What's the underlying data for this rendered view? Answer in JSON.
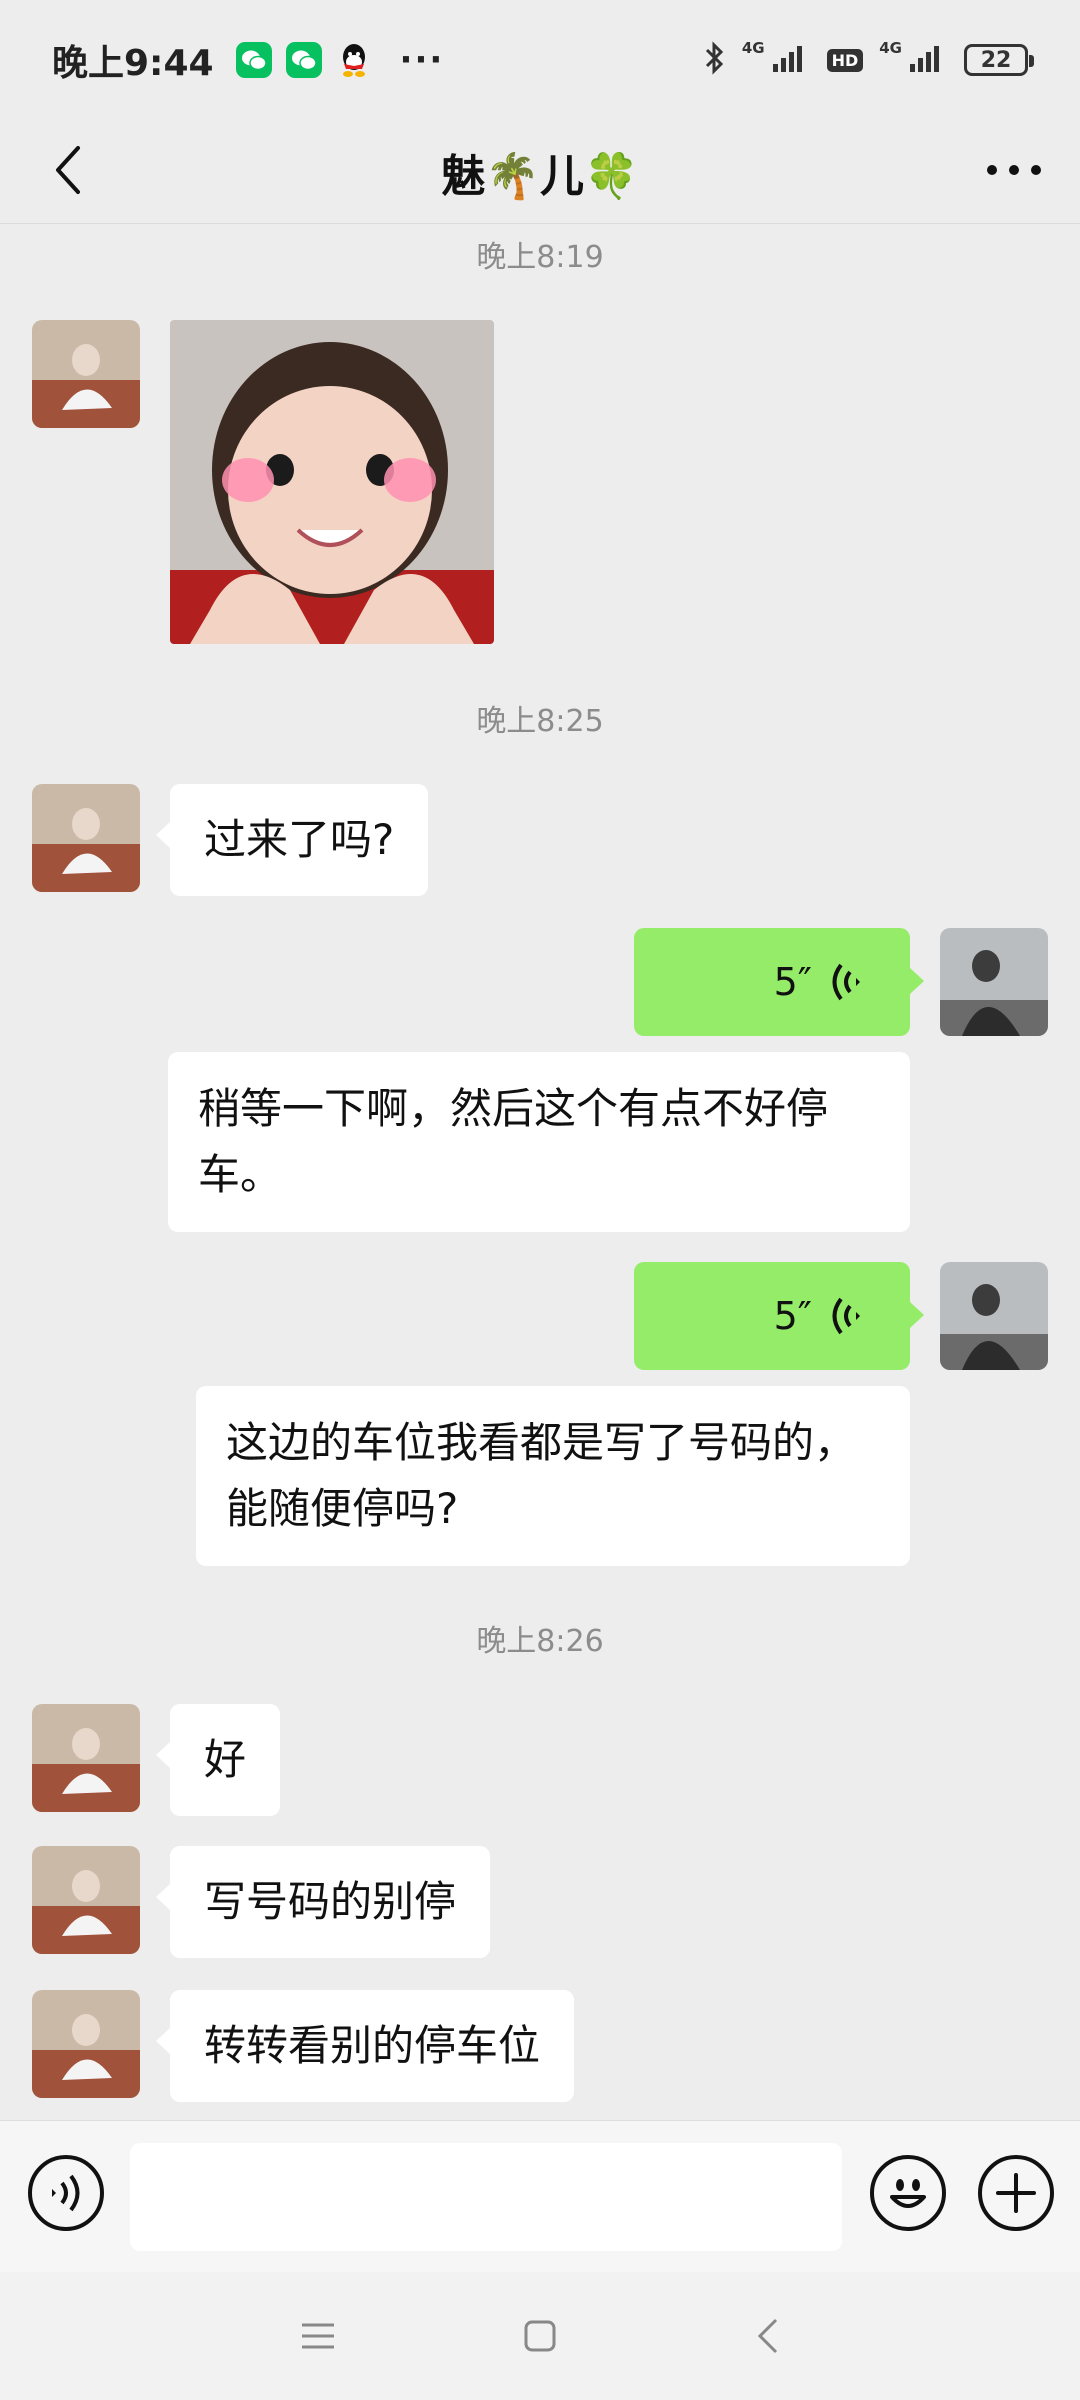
{
  "status_bar": {
    "time": "晚上9:44",
    "more": "···",
    "network_1": "4G",
    "hd": "HD",
    "network_2": "4G",
    "battery": "22"
  },
  "header": {
    "title": "魅🌴儿🍀"
  },
  "chat": {
    "timestamps": [
      "晚上8:19",
      "晚上8:25",
      "晚上8:26"
    ],
    "messages": [
      {
        "text": "过来了吗?"
      },
      {
        "duration": "5″",
        "transcript": "稍等一下啊，然后这个有点不好停车。"
      },
      {
        "duration": "5″",
        "transcript": "这边的车位我看都是写了号码的，能随便停吗?"
      },
      {
        "text": "好"
      },
      {
        "text": "写号码的别停"
      },
      {
        "text": "转转看别的停车位"
      }
    ]
  },
  "input_bar": {
    "placeholder": ""
  },
  "colors": {
    "background": "#ededed",
    "incoming_bubble": "#ffffff",
    "outgoing_bubble": "#95ec69",
    "wechat_green": "#07c160"
  },
  "icons": {
    "back": "chevron-left-icon",
    "more": "more-dots-icon",
    "voice_mode": "voice-icon",
    "emoji": "emoji-icon",
    "add": "plus-circle-icon"
  }
}
